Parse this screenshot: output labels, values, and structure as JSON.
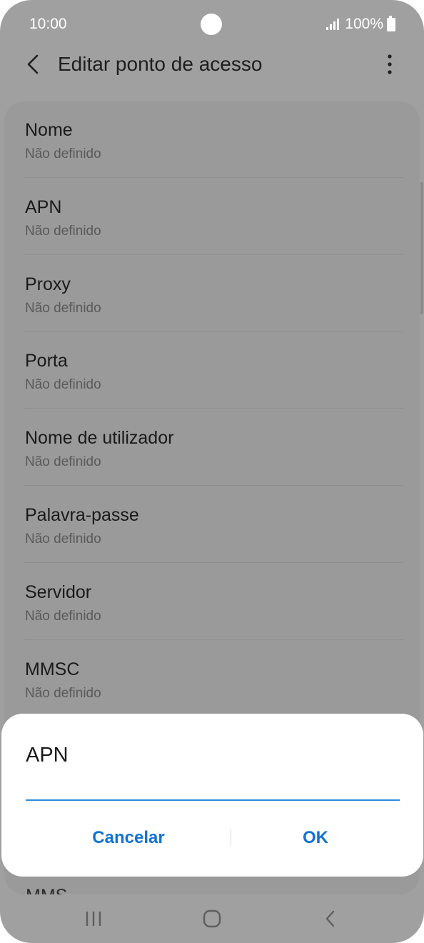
{
  "status_bar": {
    "time": "10:00",
    "battery": "100%"
  },
  "header": {
    "title": "Editar ponto de acesso"
  },
  "settings": [
    {
      "title": "Nome",
      "value": "Não definido"
    },
    {
      "title": "APN",
      "value": "Não definido"
    },
    {
      "title": "Proxy",
      "value": "Não definido"
    },
    {
      "title": "Porta",
      "value": "Não definido"
    },
    {
      "title": "Nome de utilizador",
      "value": "Não definido"
    },
    {
      "title": "Palavra-passe",
      "value": "Não definido"
    },
    {
      "title": "Servidor",
      "value": "Não definido"
    },
    {
      "title": "MMSC",
      "value": "Não definido"
    }
  ],
  "partial_item": "MMS",
  "dialog": {
    "title": "APN",
    "input_value": "",
    "cancel_label": "Cancelar",
    "ok_label": "OK"
  },
  "icons": {
    "back": "back-arrow-icon",
    "more": "more-vertical-icon",
    "nav_recent": "recent-apps-icon",
    "nav_home": "home-icon",
    "nav_back": "nav-back-icon"
  },
  "colors": {
    "dim_background": "#a0a0a0",
    "dialog_background": "#ffffff",
    "accent": "#1273cf",
    "input_underline": "#2e8ad8"
  }
}
